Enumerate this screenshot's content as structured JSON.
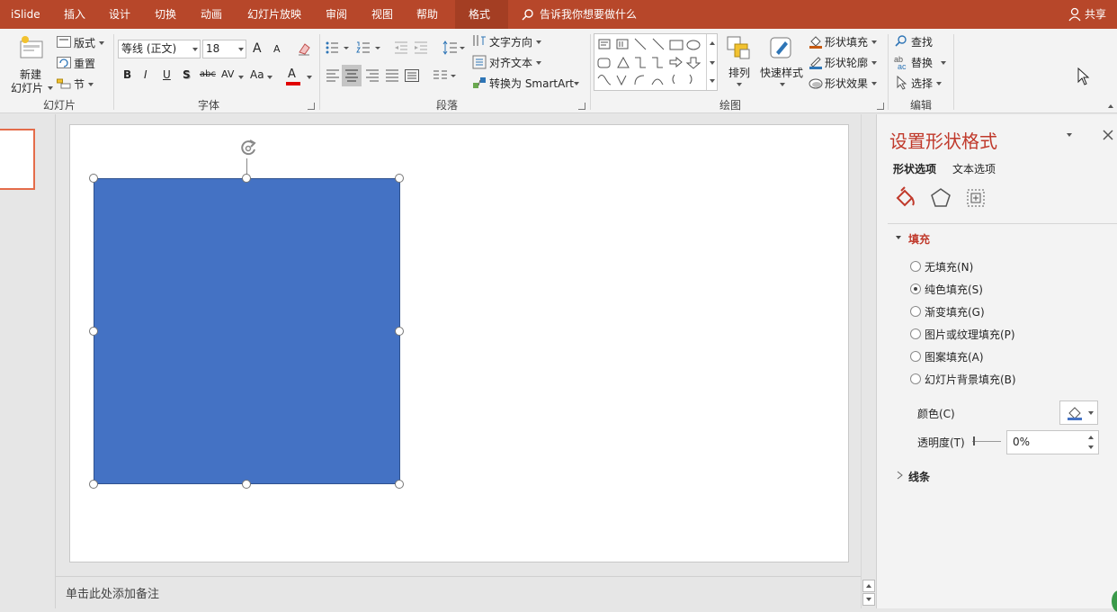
{
  "menubar": {
    "app": "iSlide",
    "tabs": [
      "插入",
      "设计",
      "切换",
      "动画",
      "幻灯片放映",
      "审阅",
      "视图",
      "帮助"
    ],
    "active_tab": "格式",
    "tell_me": "告诉我你想要做什么",
    "share": "共享",
    "colors": {
      "bar": "#b7472a",
      "active": "#a43e23"
    }
  },
  "ribbon": {
    "slides": {
      "new_slide_line1": "新建",
      "new_slide_line2": "幻灯片",
      "layout": "版式",
      "reset": "重置",
      "section": "节",
      "label": "幻灯片"
    },
    "font": {
      "name": "等线 (正文)",
      "size": "18",
      "bold": "B",
      "italic": "I",
      "underline": "U",
      "shadow": "S",
      "strike": "abc",
      "spacing": "AV",
      "case": "Aa",
      "color": "A",
      "grow": "A",
      "shrink": "A",
      "label": "字体"
    },
    "paragraph": {
      "text_direction": "文字方向",
      "align_text": "对齐文本",
      "convert_smartart": "转换为 SmartArt",
      "label": "段落"
    },
    "drawing": {
      "arrange": "排列",
      "quick_styles": "快速样式",
      "shape_fill": "形状填充",
      "shape_outline": "形状轮廓",
      "shape_effects": "形状效果",
      "label": "绘图"
    },
    "editing": {
      "find": "查找",
      "replace": "替换",
      "select": "选择",
      "label": "编辑"
    }
  },
  "notes": {
    "placeholder": "单击此处添加备注"
  },
  "slide": {
    "shape_color": "#4472c4"
  },
  "pane": {
    "title": "设置形状格式",
    "tabs": {
      "shape_options": "形状选项",
      "text_options": "文本选项"
    },
    "fill_section": "填充",
    "options": [
      {
        "label": "无填充(N)",
        "checked": false
      },
      {
        "label": "纯色填充(S)",
        "checked": true
      },
      {
        "label": "渐变填充(G)",
        "checked": false
      },
      {
        "label": "图片或纹理填充(P)",
        "checked": false
      },
      {
        "label": "图案填充(A)",
        "checked": false
      },
      {
        "label": "幻灯片背景填充(B)",
        "checked": false
      }
    ],
    "color_label": "颜色(C)",
    "transparency_label": "透明度(T)",
    "transparency_value": "0%",
    "line_section": "线条",
    "accent": "#c0392b"
  }
}
